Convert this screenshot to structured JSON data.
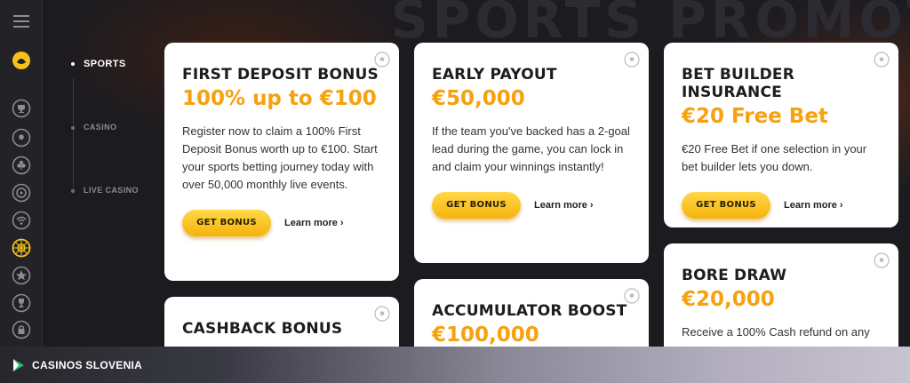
{
  "page": {
    "hero_title": "SPORTS PROMOTIONS"
  },
  "subnav": {
    "items": [
      {
        "label": "SPORTS",
        "active": true
      },
      {
        "label": "CASINO",
        "active": false
      },
      {
        "label": "LIVE CASINO",
        "active": false
      }
    ]
  },
  "rail": {
    "icons": [
      "menu-icon",
      "tiger-logo-icon",
      "trophy-icon",
      "soccer-ball-icon",
      "club-icon",
      "roulette-icon",
      "live-signal-icon",
      "wheel-icon",
      "star-badge-icon",
      "cup-icon",
      "lock-icon"
    ],
    "accent": "#f6c21a"
  },
  "cards": [
    {
      "title": "FIRST DEPOSIT BONUS",
      "amount": "100% up to €100",
      "text": "Register now to claim a 100% First Deposit Bonus worth up to €100. Start your sports betting journey today with over 50,000 monthly live events.",
      "button": "GET BONUS",
      "learn": "Learn more"
    },
    {
      "title": "EARLY PAYOUT",
      "amount": "€50,000",
      "text": "If the team you've backed has a 2-goal lead during the game, you can lock in and claim your winnings instantly!",
      "button": "GET BONUS",
      "learn": "Learn more"
    },
    {
      "title": "BET BUILDER INSURANCE",
      "amount": "€20 Free Bet",
      "text": "€20 Free Bet if one selection in your bet builder lets you down.",
      "button": "GET BONUS",
      "learn": "Learn more"
    },
    {
      "title": "CASHBACK BONUS"
    },
    {
      "title": "ACCUMULATOR BOOST",
      "amount": "€100,000"
    },
    {
      "title": "BORE DRAW",
      "amount": "€20,000",
      "text": "Receive a 100% Cash refund on any"
    }
  ],
  "footer": {
    "brand": "CASINOS SLOVENIA"
  },
  "colors": {
    "amount": "#f6a10f",
    "button_top": "#ffd84a",
    "button_bottom": "#f5b30a",
    "background": "#1b1b20"
  }
}
